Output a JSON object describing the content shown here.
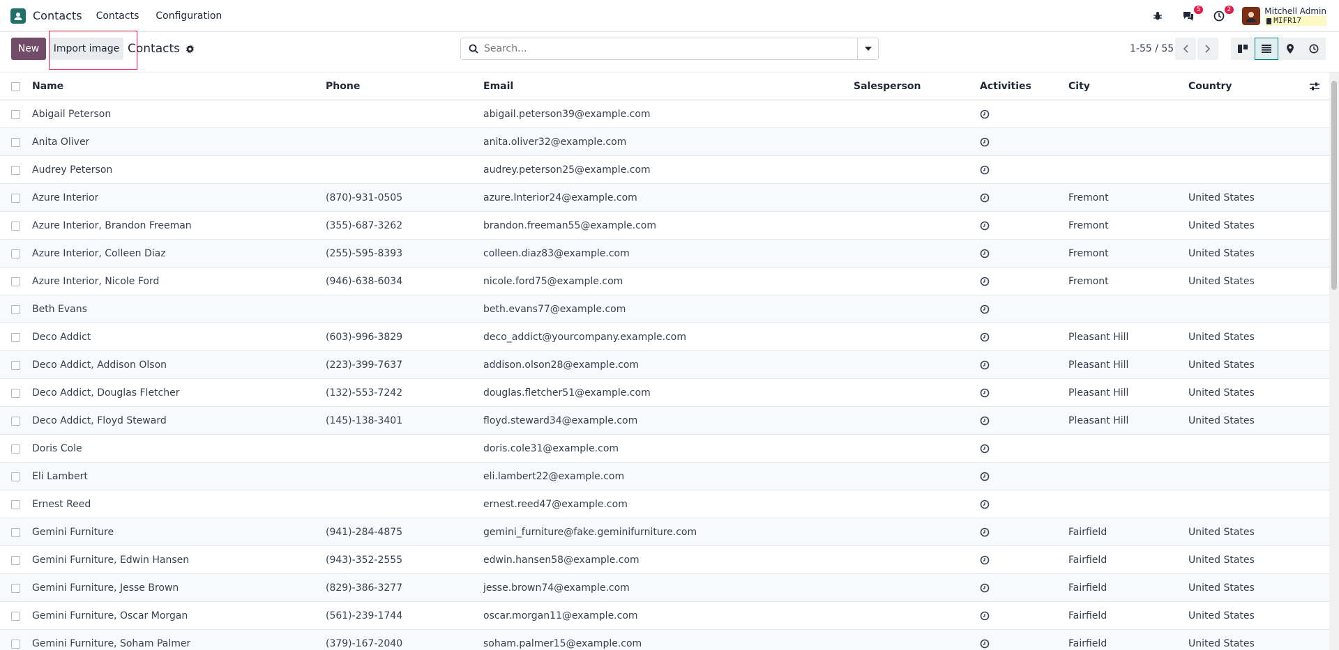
{
  "app": {
    "name": "Contacts",
    "menu": [
      "Contacts",
      "Configuration"
    ]
  },
  "systray": {
    "messages_count": "5",
    "activities_count": "2",
    "user_name": "Mitchell Admin",
    "db_name": "MIFR17"
  },
  "control": {
    "new_label": "New",
    "import_label": "Import image",
    "breadcrumb": "Contacts",
    "search_placeholder": "Search...",
    "pager": "1-55 / 55"
  },
  "table": {
    "headers": {
      "name": "Name",
      "phone": "Phone",
      "email": "Email",
      "salesperson": "Salesperson",
      "activities": "Activities",
      "city": "City",
      "country": "Country"
    },
    "rows": [
      {
        "name": "Abigail Peterson",
        "phone": "",
        "email": "abigail.peterson39@example.com",
        "salesperson": "",
        "city": "",
        "country": ""
      },
      {
        "name": "Anita Oliver",
        "phone": "",
        "email": "anita.oliver32@example.com",
        "salesperson": "",
        "city": "",
        "country": ""
      },
      {
        "name": "Audrey Peterson",
        "phone": "",
        "email": "audrey.peterson25@example.com",
        "salesperson": "",
        "city": "",
        "country": ""
      },
      {
        "name": "Azure Interior",
        "phone": "(870)-931-0505",
        "email": "azure.Interior24@example.com",
        "salesperson": "",
        "city": "Fremont",
        "country": "United States"
      },
      {
        "name": "Azure Interior, Brandon Freeman",
        "phone": "(355)-687-3262",
        "email": "brandon.freeman55@example.com",
        "salesperson": "",
        "city": "Fremont",
        "country": "United States"
      },
      {
        "name": "Azure Interior, Colleen Diaz",
        "phone": "(255)-595-8393",
        "email": "colleen.diaz83@example.com",
        "salesperson": "",
        "city": "Fremont",
        "country": "United States"
      },
      {
        "name": "Azure Interior, Nicole Ford",
        "phone": "(946)-638-6034",
        "email": "nicole.ford75@example.com",
        "salesperson": "",
        "city": "Fremont",
        "country": "United States"
      },
      {
        "name": "Beth Evans",
        "phone": "",
        "email": "beth.evans77@example.com",
        "salesperson": "",
        "city": "",
        "country": ""
      },
      {
        "name": "Deco Addict",
        "phone": "(603)-996-3829",
        "email": "deco_addict@yourcompany.example.com",
        "salesperson": "",
        "city": "Pleasant Hill",
        "country": "United States"
      },
      {
        "name": "Deco Addict, Addison Olson",
        "phone": "(223)-399-7637",
        "email": "addison.olson28@example.com",
        "salesperson": "",
        "city": "Pleasant Hill",
        "country": "United States"
      },
      {
        "name": "Deco Addict, Douglas Fletcher",
        "phone": "(132)-553-7242",
        "email": "douglas.fletcher51@example.com",
        "salesperson": "",
        "city": "Pleasant Hill",
        "country": "United States"
      },
      {
        "name": "Deco Addict, Floyd Steward",
        "phone": "(145)-138-3401",
        "email": "floyd.steward34@example.com",
        "salesperson": "",
        "city": "Pleasant Hill",
        "country": "United States"
      },
      {
        "name": "Doris Cole",
        "phone": "",
        "email": "doris.cole31@example.com",
        "salesperson": "",
        "city": "",
        "country": ""
      },
      {
        "name": "Eli Lambert",
        "phone": "",
        "email": "eli.lambert22@example.com",
        "salesperson": "",
        "city": "",
        "country": ""
      },
      {
        "name": "Ernest Reed",
        "phone": "",
        "email": "ernest.reed47@example.com",
        "salesperson": "",
        "city": "",
        "country": ""
      },
      {
        "name": "Gemini Furniture",
        "phone": "(941)-284-4875",
        "email": "gemini_furniture@fake.geminifurniture.com",
        "salesperson": "",
        "city": "Fairfield",
        "country": "United States"
      },
      {
        "name": "Gemini Furniture, Edwin Hansen",
        "phone": "(943)-352-2555",
        "email": "edwin.hansen58@example.com",
        "salesperson": "",
        "city": "Fairfield",
        "country": "United States"
      },
      {
        "name": "Gemini Furniture, Jesse Brown",
        "phone": "(829)-386-3277",
        "email": "jesse.brown74@example.com",
        "salesperson": "",
        "city": "Fairfield",
        "country": "United States"
      },
      {
        "name": "Gemini Furniture, Oscar Morgan",
        "phone": "(561)-239-1744",
        "email": "oscar.morgan11@example.com",
        "salesperson": "",
        "city": "Fairfield",
        "country": "United States"
      },
      {
        "name": "Gemini Furniture, Soham Palmer",
        "phone": "(379)-167-2040",
        "email": "soham.palmer15@example.com",
        "salesperson": "",
        "city": "Fairfield",
        "country": "United States"
      }
    ]
  },
  "icons": {
    "app": "contacts-app-icon",
    "debug": "bug-icon",
    "messages": "chat-icon",
    "activities": "clock-icon",
    "settings": "gear-icon",
    "search": "search-icon",
    "toggle": "caret-down-icon",
    "prev": "chevron-left-icon",
    "next": "chevron-right-icon",
    "kanban": "kanban-view-icon",
    "list": "list-view-icon",
    "map": "map-pin-icon",
    "activity_view": "activity-view-icon",
    "optional_columns": "sliders-icon"
  },
  "colors": {
    "brand": "#714b67",
    "accent": "#017e84",
    "badge": "#e11d48"
  }
}
